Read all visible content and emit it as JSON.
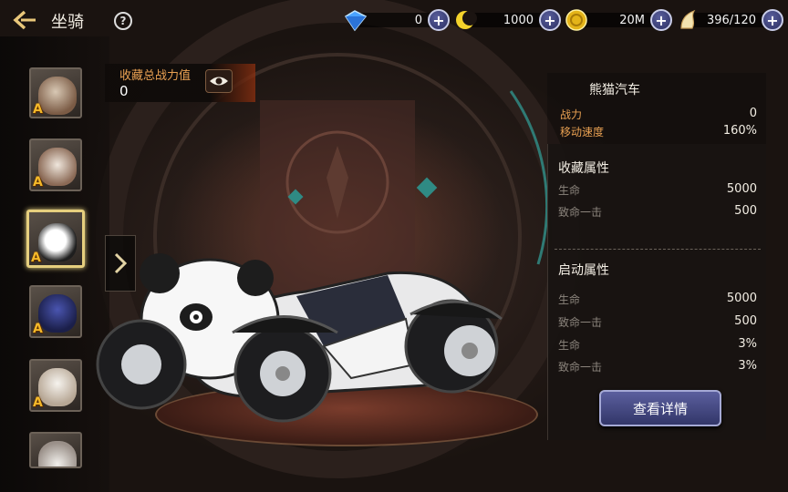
{
  "header": {
    "title": "坐骑",
    "help": "?"
  },
  "resources": [
    {
      "icon": "blue-gem-icon",
      "value": "0"
    },
    {
      "icon": "yellow-crescent-icon",
      "value": "1000"
    },
    {
      "icon": "gold-coin-icon",
      "value": "20M"
    },
    {
      "icon": "flame-wing-icon",
      "value": "396/120"
    }
  ],
  "collection_power": {
    "label": "收藏总战力值",
    "value": "0"
  },
  "mount_list": [
    {
      "grade": "A",
      "icon": "warthog-mount-icon"
    },
    {
      "grade": "A",
      "icon": "deer-mount-icon"
    },
    {
      "grade": "A",
      "icon": "panda-car-mount-icon",
      "selected": true
    },
    {
      "grade": "A",
      "icon": "blue-beast-mount-icon"
    },
    {
      "grade": "A",
      "icon": "alpaca-mount-icon"
    },
    {
      "grade": "",
      "icon": "white-mount-icon"
    }
  ],
  "mount": {
    "name": "熊猫汽车",
    "stats": [
      {
        "label": "战力",
        "value": "0"
      },
      {
        "label": "移动速度",
        "value": "160%"
      }
    ]
  },
  "collection_attrs": {
    "title": "收藏属性",
    "rows": [
      {
        "label": "生命",
        "value": "5000"
      },
      {
        "label": "致命一击",
        "value": "500"
      }
    ]
  },
  "active_attrs": {
    "title": "启动属性",
    "rows": [
      {
        "label": "生命",
        "value": "5000"
      },
      {
        "label": "致命一击",
        "value": "500"
      },
      {
        "label": "生命",
        "value": "3%"
      },
      {
        "label": "致命一击",
        "value": "3%"
      }
    ]
  },
  "detail_button": "查看详情",
  "colors": {
    "accent": "#e8a052",
    "button": "#454a86",
    "selected_border": "#e6cf7e",
    "grade": "#f3b829"
  }
}
